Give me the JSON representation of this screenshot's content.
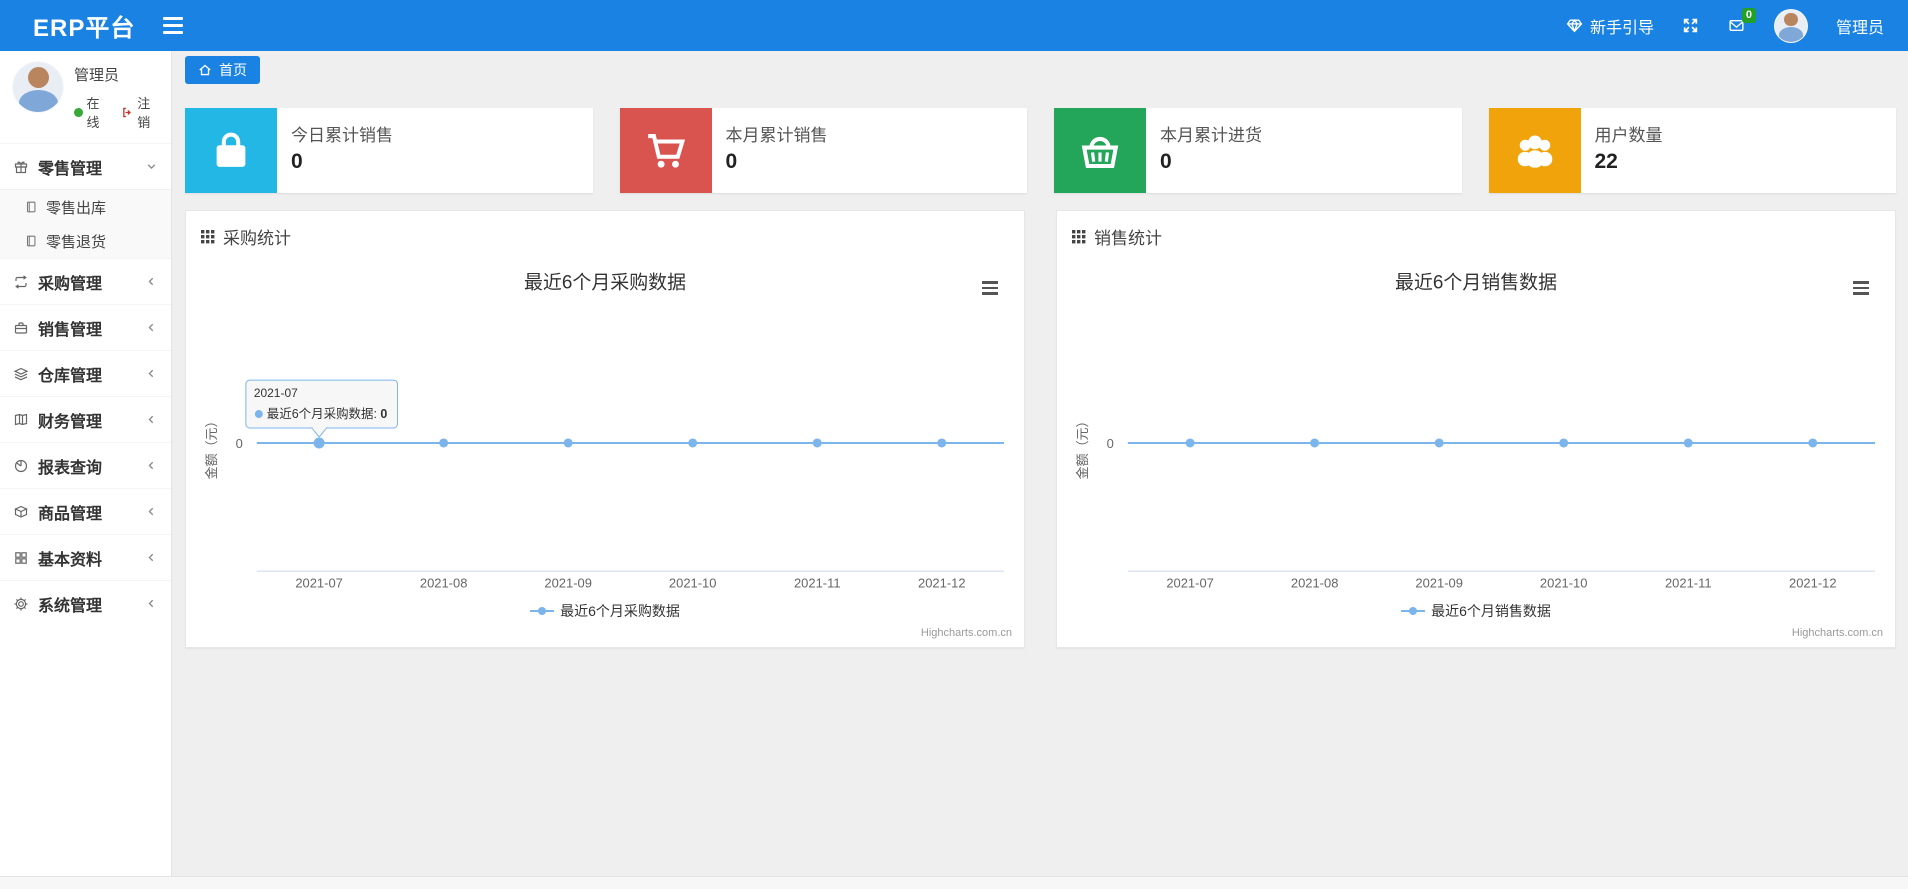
{
  "navbar": {
    "brand": "ERP平台",
    "toggle_icon": "hamburger-icon",
    "guide": {
      "icon": "gem-icon",
      "label": "新手引导"
    },
    "fullscreen_icon": "fullscreen-icon",
    "mail": {
      "icon": "envelope-icon",
      "badge": "0"
    },
    "user": {
      "avatar": "user-avatar",
      "name": "管理员"
    }
  },
  "sidebar": {
    "user": {
      "name": "管理员",
      "status": "在线",
      "logout": "注销",
      "status_color": "#38a838"
    },
    "menu": [
      {
        "label": "零售管理",
        "icon": "gift-icon",
        "expanded": true,
        "children": [
          {
            "label": "零售出库",
            "icon": "doc-icon"
          },
          {
            "label": "零售退货",
            "icon": "doc-icon"
          }
        ]
      },
      {
        "label": "采购管理",
        "icon": "exchange-icon",
        "expanded": false
      },
      {
        "label": "销售管理",
        "icon": "briefcase-icon",
        "expanded": false
      },
      {
        "label": "仓库管理",
        "icon": "layers-icon",
        "expanded": false
      },
      {
        "label": "财务管理",
        "icon": "book-icon",
        "expanded": false
      },
      {
        "label": "报表查询",
        "icon": "pie-chart-icon",
        "expanded": false
      },
      {
        "label": "商品管理",
        "icon": "box-icon",
        "expanded": false
      },
      {
        "label": "基本资料",
        "icon": "grid-icon",
        "expanded": false
      },
      {
        "label": "系统管理",
        "icon": "gear-icon",
        "expanded": false
      }
    ]
  },
  "breadcrumb": {
    "icon": "home-icon",
    "label": "首页"
  },
  "stat_cards": [
    {
      "label": "今日累计销售",
      "value": "0",
      "color": "#23b7e5",
      "icon": "shopping-bag-icon"
    },
    {
      "label": "本月累计销售",
      "value": "0",
      "color": "#d9534f",
      "icon": "shopping-cart-icon"
    },
    {
      "label": "本月累计进货",
      "value": "0",
      "color": "#23a65a",
      "icon": "shopping-basket-icon"
    },
    {
      "label": "用户数量",
      "value": "22",
      "color": "#f0a30a",
      "icon": "users-icon"
    }
  ],
  "chart_data": [
    {
      "type": "line",
      "panel_title": "采购统计",
      "title": "最近6个月采购数据",
      "categories": [
        "2021-07",
        "2021-08",
        "2021-09",
        "2021-10",
        "2021-11",
        "2021-12"
      ],
      "series": [
        {
          "name": "最近6个月采购数据",
          "values": [
            0,
            0,
            0,
            0,
            0,
            0
          ]
        }
      ],
      "xlabel": "",
      "ylabel": "金额（元）",
      "yticks": [
        "0"
      ],
      "ylim": [
        -1,
        1
      ],
      "grid": false,
      "legend_position": "bottom",
      "line_color": "#7cb5ec",
      "axis_color": "#ccd6eb",
      "tooltip": {
        "header": "2021-07",
        "series": "最近6个月采购数据",
        "value": "0"
      },
      "credit": "Highcharts.com.cn"
    },
    {
      "type": "line",
      "panel_title": "销售统计",
      "title": "最近6个月销售数据",
      "categories": [
        "2021-07",
        "2021-08",
        "2021-09",
        "2021-10",
        "2021-11",
        "2021-12"
      ],
      "series": [
        {
          "name": "最近6个月销售数据",
          "values": [
            0,
            0,
            0,
            0,
            0,
            0
          ]
        }
      ],
      "xlabel": "",
      "ylabel": "金额（元）",
      "yticks": [
        "0"
      ],
      "ylim": [
        -1,
        1
      ],
      "grid": false,
      "legend_position": "bottom",
      "line_color": "#7cb5ec",
      "axis_color": "#ccd6eb",
      "credit": "Highcharts.com.cn"
    }
  ]
}
